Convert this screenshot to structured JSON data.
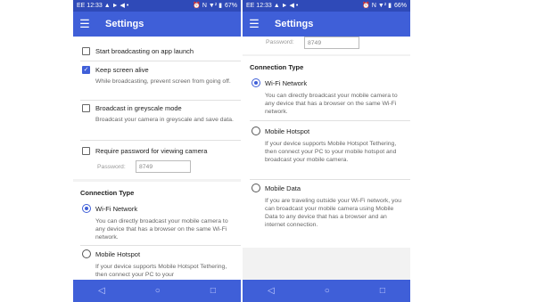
{
  "left": {
    "status": {
      "carrier": "EE",
      "time": "12:33",
      "icons_left": "▲ ► ◀ •",
      "icons_right": "⏰ N ▼² ▮",
      "battery": "67%"
    },
    "appbar": {
      "menu_icon": "☰",
      "title": "Settings"
    },
    "options": [
      {
        "label": "Start broadcasting on app launch",
        "checked": false
      },
      {
        "label": "Keep screen alive",
        "checked": true,
        "desc": "While broadcasting, prevent screen from going off."
      },
      {
        "label": "Broadcast in greyscale mode",
        "checked": false,
        "desc": "Broadcast your camera in greyscale and save data."
      },
      {
        "label": "Require password for viewing camera",
        "checked": false
      }
    ],
    "password": {
      "label": "Password:",
      "value": "8749"
    },
    "section": "Connection Type",
    "connections": [
      {
        "label": "Wi-Fi Network",
        "selected": true,
        "desc": "You can directly broadcast your mobile camera to any device that has a browser on the same Wi-Fi network."
      },
      {
        "label": "Mobile Hotspot",
        "selected": false,
        "desc": "If your device supports Mobile Hotspot Tethering, then connect your PC to your"
      }
    ]
  },
  "right": {
    "status": {
      "carrier": "EE",
      "time": "12:33",
      "icons_left": "▲ ► ◀ •",
      "icons_right": "⏰ N ▼² ▮",
      "battery": "66%"
    },
    "appbar": {
      "menu_icon": "☰",
      "title": "Settings"
    },
    "password": {
      "label": "Password:",
      "value": "8749"
    },
    "section": "Connection Type",
    "connections": [
      {
        "label": "Wi-Fi Network",
        "selected": true,
        "desc": "You can directly broadcast your mobile camera to any device that has a browser on the same Wi-Fi network."
      },
      {
        "label": "Mobile Hotspot",
        "selected": false,
        "desc": "If your device supports Mobile Hotspot Tethering, then connect your PC to your mobile hotspot and broadcast your mobile camera."
      },
      {
        "label": "Mobile Data",
        "selected": false,
        "desc": "If you are traveling outside your Wi-Fi network, you can broadcast your mobile camera using Mobile Data to any device that has a browser and an internet connection."
      }
    ]
  },
  "nav": {
    "back": "◁",
    "home": "○",
    "recents": "□"
  },
  "colors": {
    "primary": "#3f5fd8",
    "status_bar": "#2f4ab8",
    "background": "#f2f2f2"
  }
}
